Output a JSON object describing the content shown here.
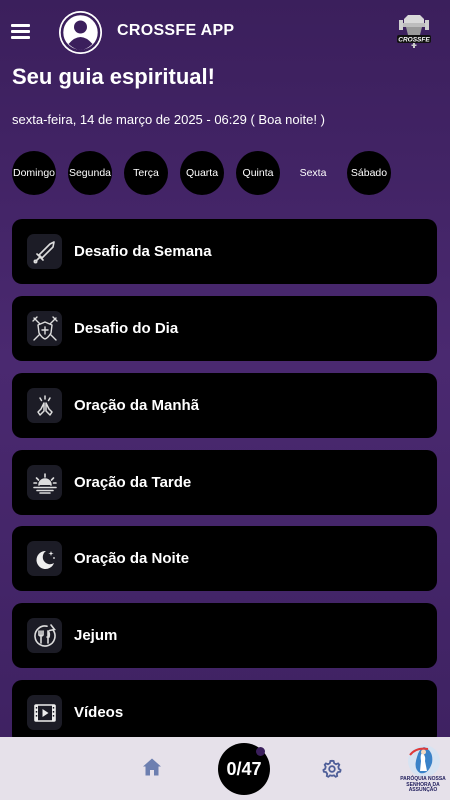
{
  "header": {
    "app_title": "CROSSFE APP",
    "logo_text": "CROSSFE"
  },
  "page": {
    "title": "Seu guia espiritual!",
    "date_line": "sexta-feira, 14 de março de 2025 - 06:29 ( Boa noite! )"
  },
  "days": [
    {
      "label": "Domingo",
      "active": false
    },
    {
      "label": "Segunda",
      "active": false
    },
    {
      "label": "Terça",
      "active": false
    },
    {
      "label": "Quarta",
      "active": false
    },
    {
      "label": "Quinta",
      "active": false
    },
    {
      "label": "Sexta",
      "active": true
    },
    {
      "label": "Sábado",
      "active": false
    }
  ],
  "cards": [
    {
      "label": "Desafio da Semana",
      "icon": "sword-icon"
    },
    {
      "label": "Desafio do Dia",
      "icon": "shield-swords-icon"
    },
    {
      "label": "Oração da Manhã",
      "icon": "praying-hands-icon"
    },
    {
      "label": "Oração da Tarde",
      "icon": "sunset-icon"
    },
    {
      "label": "Oração da Noite",
      "icon": "moon-stars-icon"
    },
    {
      "label": "Jejum",
      "icon": "fasting-icon"
    },
    {
      "label": "Vídeos",
      "icon": "video-icon"
    }
  ],
  "bottom_nav": {
    "counter": "0/47",
    "parish_text": "PARÓQUIA NOSSA SENHORA DA ASSUNÇÃO"
  },
  "colors": {
    "background": "#3b1f5c",
    "card": "#000000",
    "bottom_bar": "#e6e1ea",
    "icon_blue": "#6d7fb0"
  }
}
